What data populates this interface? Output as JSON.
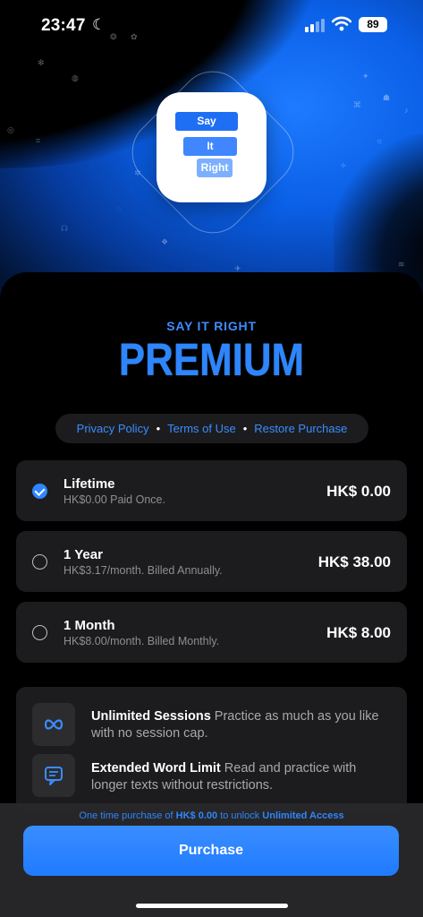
{
  "status_bar": {
    "time": "23:47",
    "battery": "89"
  },
  "app_icon": {
    "chips": [
      "Say",
      "It",
      "Right"
    ]
  },
  "header": {
    "kicker": "SAY IT RIGHT",
    "title": "PREMIUM"
  },
  "links": {
    "privacy": "Privacy Policy",
    "terms": "Terms of Use",
    "restore": "Restore Purchase",
    "separator": "•"
  },
  "plans": [
    {
      "name": "Lifetime",
      "subtitle": "HK$0.00 Paid Once.",
      "price": "HK$ 0.00",
      "selected": true
    },
    {
      "name": "1 Year",
      "subtitle": "HK$3.17/month. Billed Annually.",
      "price": "HK$ 38.00",
      "selected": false
    },
    {
      "name": "1 Month",
      "subtitle": "HK$8.00/month. Billed Monthly.",
      "price": "HK$ 8.00",
      "selected": false
    }
  ],
  "features": [
    {
      "title": "Unlimited Sessions",
      "description": "Practice as much as you like with no session cap.",
      "icon": "infinity-icon"
    },
    {
      "title": "Extended Word Limit",
      "description": "Read and practice with longer texts without restrictions.",
      "icon": "text-bubble-icon"
    }
  ],
  "purchase_note": {
    "prefix": "One time purchase of",
    "amount": "HK$ 0.00",
    "middle": "to unlock",
    "target": "Unlimited Access"
  },
  "purchase_button": "Purchase",
  "colors": {
    "accent": "#2f86ff",
    "card": "#1c1c1e",
    "background": "#000000"
  }
}
